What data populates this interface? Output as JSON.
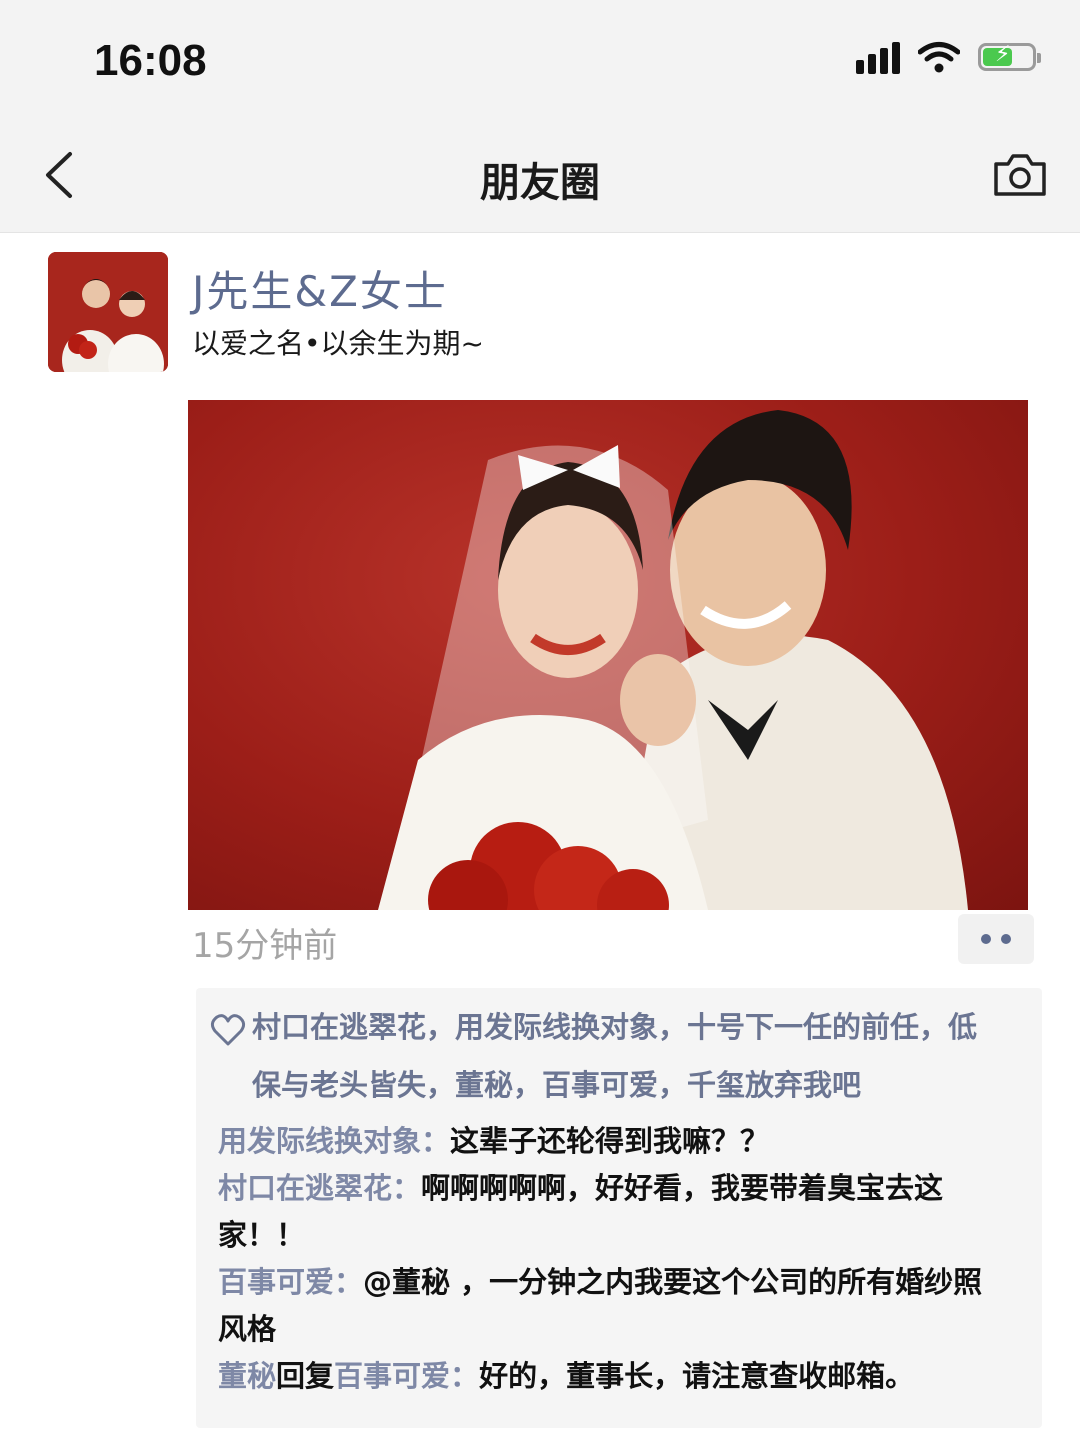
{
  "status_bar": {
    "time": "16:08"
  },
  "nav": {
    "title": "朋友圈"
  },
  "post": {
    "user_name": "J先生&Z女士",
    "text": "以爱之名•以余生为期~",
    "timestamp": "15分钟前",
    "likes": "村口在逃翠花，用发际线换对象，十号下一任的前任，低保与老头皆失，董秘，百事可爱，千玺放弃我吧",
    "comments": [
      {
        "author": "用发际线换对象",
        "separator": "：",
        "text": "这辈子还轮得到我嘛？？"
      },
      {
        "author": "村口在逃翠花",
        "separator": "：",
        "text": "啊啊啊啊啊，好好看，我要带着臭宝去这家！！"
      },
      {
        "author": "百事可爱",
        "separator": "：",
        "text": "@董秘 ，一分钟之内我要这个公司的所有婚纱照风格"
      },
      {
        "author": "董秘",
        "reply_word": "回复",
        "reply_to": "百事可爱",
        "separator": "：",
        "text": "好的，董事长，请注意查收邮箱。"
      }
    ]
  },
  "colors": {
    "name_blue": "#5d6b8f",
    "photo_red": "#a8261d",
    "battery_green": "#4bc94e"
  }
}
